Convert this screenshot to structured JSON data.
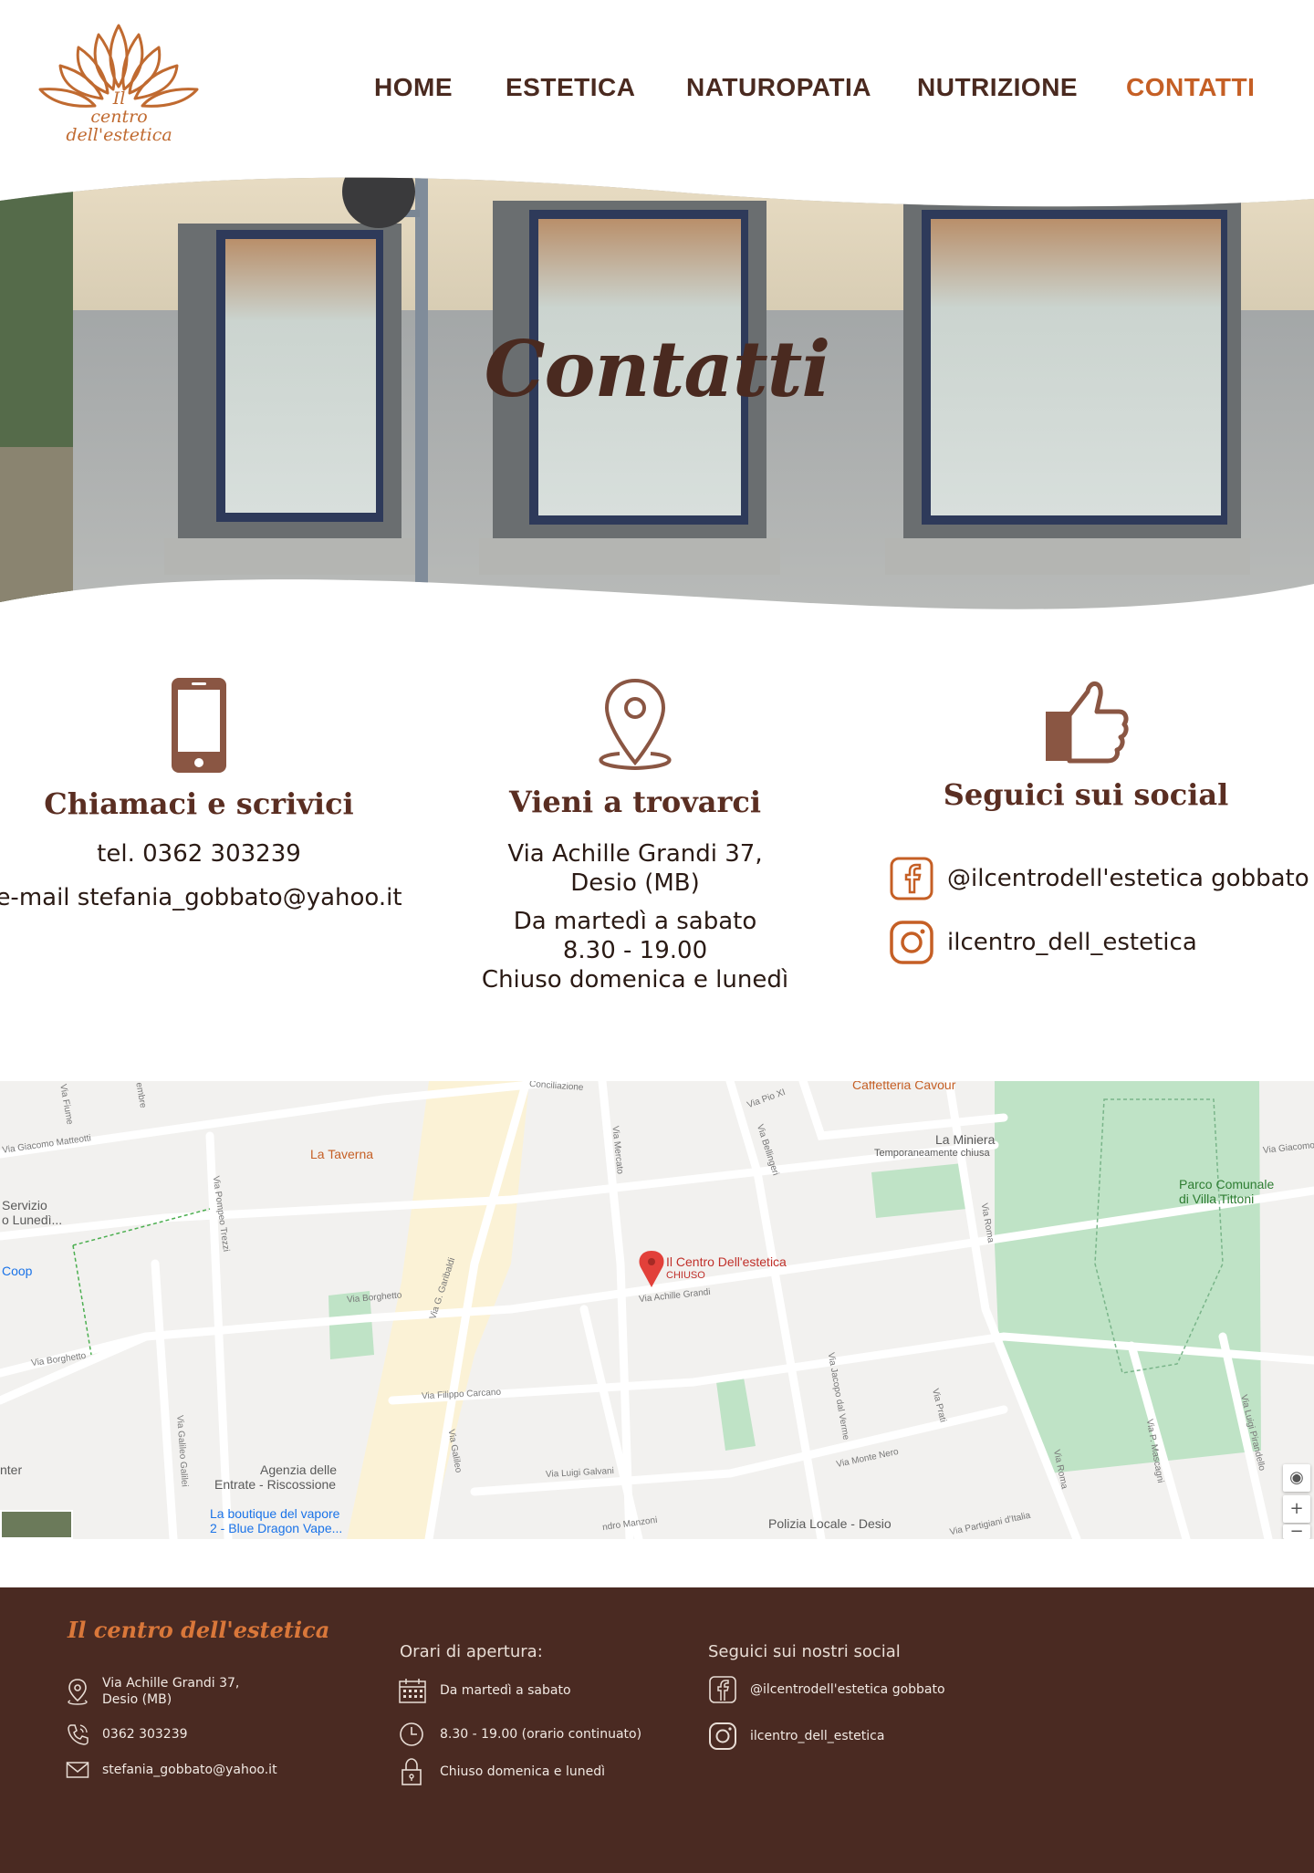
{
  "brand": {
    "logo_line1": "Il",
    "logo_line2": "centro",
    "logo_line3": "dell'estetica",
    "accent_color": "#c55f25",
    "dark_color": "#4a2a20"
  },
  "nav": {
    "items": [
      {
        "label": "HOME"
      },
      {
        "label": "ESTETICA"
      },
      {
        "label": "NATUROPATIA"
      },
      {
        "label": "NUTRIZIONE"
      },
      {
        "label": "CONTATTI",
        "active": true
      }
    ]
  },
  "hero": {
    "title": "Contatti"
  },
  "contacts": {
    "call": {
      "icon": "phone-icon",
      "title": "Chiamaci e scrivici",
      "phone": "tel. 0362 303239",
      "email": "e-mail stefania_gobbato@yahoo.it"
    },
    "visit": {
      "icon": "map-pin-icon",
      "title": "Vieni a trovarci",
      "address_line1": "Via Achille Grandi 37,",
      "address_line2": "Desio (MB)",
      "hours_line1": "Da martedì a sabato",
      "hours_line2": "8.30 - 19.00",
      "hours_line3": "Chiuso domenica e lunedì"
    },
    "social": {
      "icon": "thumbs-up-icon",
      "title": "Seguici sui social",
      "facebook": "@ilcentrodell'estetica gobbato",
      "instagram": "ilcentro_dell_estetica"
    }
  },
  "map": {
    "marker_name": "Il Centro Dell'estetica",
    "marker_status": "CHIUSO",
    "places": [
      "La Taverna",
      "La Miniera",
      "Temporaneamente chiusa",
      "Parco Comunale",
      "di Villa Tittoni",
      "Servizio",
      "o Lunedì...",
      "Coop",
      "Agenzia delle",
      "Entrate - Riscossione",
      "La boutique del vapore",
      "2 - Blue Dragon Vape...",
      "Polizia Locale - Desio",
      "Caffetteria Cavour",
      "nter"
    ],
    "streets": [
      "Via Giacomo Matteotti",
      "Via Borghetto",
      "Via Borghetto",
      "Via G. Garibaldi",
      "Via Pompeo Trezzi",
      "Via Mercato",
      "Via Pio XI",
      "Via Bellingeri",
      "Via Achille Grandi",
      "Via Roma",
      "Via Filippo Carcano",
      "Via Galileo Galilei",
      "Via Galileo",
      "Via Luigi Galvani",
      "Via Jacopo dal Verme",
      "Via Prati",
      "Via Monte Nero",
      "Via Roma",
      "Via P. Mascagni",
      "Via Luigi Pirandello",
      "Via Partigiani d'Italia",
      "Via Giacomo",
      "Conciliazione",
      "Via Fiume",
      "embre",
      "ndro Manzoni"
    ],
    "controls": [
      "◉",
      "+",
      "−"
    ]
  },
  "footer": {
    "title": "Il centro dell'estetica",
    "address_line1": "Via Achille Grandi 37,",
    "address_line2": "Desio (MB)",
    "phone": "0362 303239",
    "email": "stefania_gobbato@yahoo.it",
    "hours_title": "Orari di apertura:",
    "hours_days": "Da martedì a sabato",
    "hours_time": "8.30 - 19.00 (orario continuato)",
    "hours_closed": "Chiuso domenica e lunedì",
    "social_title": "Seguici sui nostri social",
    "facebook": "@ilcentrodell'estetica gobbato",
    "instagram": "ilcentro_dell_estetica",
    "background": "#4a2a22"
  }
}
